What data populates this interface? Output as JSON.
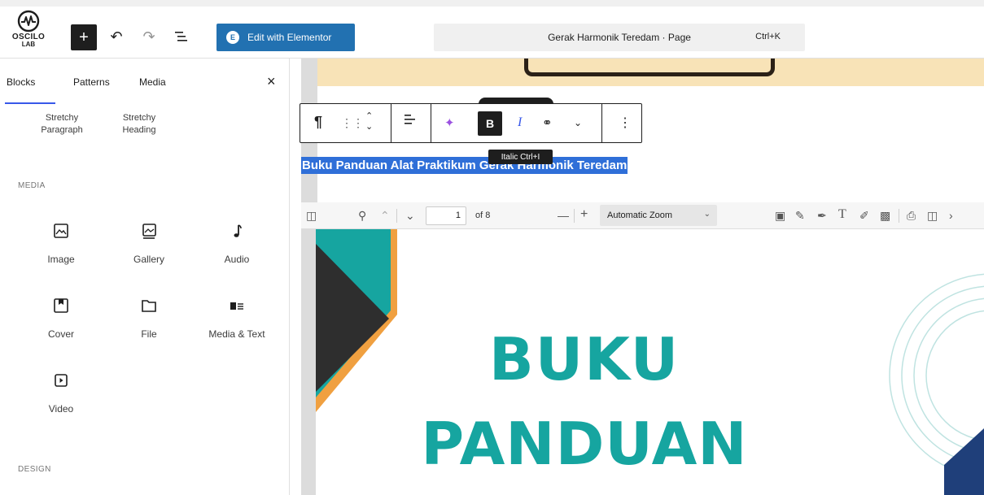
{
  "logo": {
    "line1": "OSCILO",
    "line2": "LAB"
  },
  "toolbar": {
    "add_icon": "plus-icon",
    "undo_icon": "undo-icon",
    "redo_icon": "redo-icon",
    "outline_icon": "document-overview-icon",
    "elementor_label": "Edit with Elementor",
    "command_title": "Gerak Harmonik Teredam · Page",
    "command_shortcut": "Ctrl+K"
  },
  "sidebar": {
    "tabs": [
      "Blocks",
      "Patterns",
      "Media"
    ],
    "active_tab": "Blocks",
    "previous_blocks": [
      {
        "label": "Stretchy Paragraph"
      },
      {
        "label": "Stretchy Heading"
      }
    ],
    "media_heading": "MEDIA",
    "media_blocks": [
      {
        "label": "Image",
        "icon": "image-icon"
      },
      {
        "label": "Gallery",
        "icon": "gallery-icon"
      },
      {
        "label": "Audio",
        "icon": "audio-icon"
      },
      {
        "label": "Cover",
        "icon": "cover-icon"
      },
      {
        "label": "File",
        "icon": "file-icon"
      },
      {
        "label": "Media & Text",
        "icon": "media-text-icon"
      },
      {
        "label": "Video",
        "icon": "video-icon"
      }
    ],
    "design_heading": "DESIGN"
  },
  "block_toolbar": {
    "items": [
      "paragraph-icon",
      "drag-handle-icon",
      "move-up-down-icon",
      "align-icon",
      "ai-sparkle-icon",
      "bold-icon",
      "italic-icon",
      "link-icon",
      "more-rich-text-icon",
      "options-icon"
    ],
    "bold_label": "B",
    "italic_label": "I",
    "tooltip": "Italic  Ctrl+I"
  },
  "heading": {
    "text": "Buku Panduan Alat Praktikum Gerak Harmonik Teredam"
  },
  "pdf_viewer": {
    "page_number": "1",
    "page_total": "of 8",
    "zoom": "Automatic Zoom",
    "title_line1": "BUKU",
    "title_line2": "PANDUAN"
  },
  "colors": {
    "accent_blue": "#2271b1",
    "selection_blue": "#2f6fd8",
    "pdf_teal": "#16a5a0",
    "pdf_orange": "#f0a040",
    "banner_cream": "#f8e3b7"
  }
}
